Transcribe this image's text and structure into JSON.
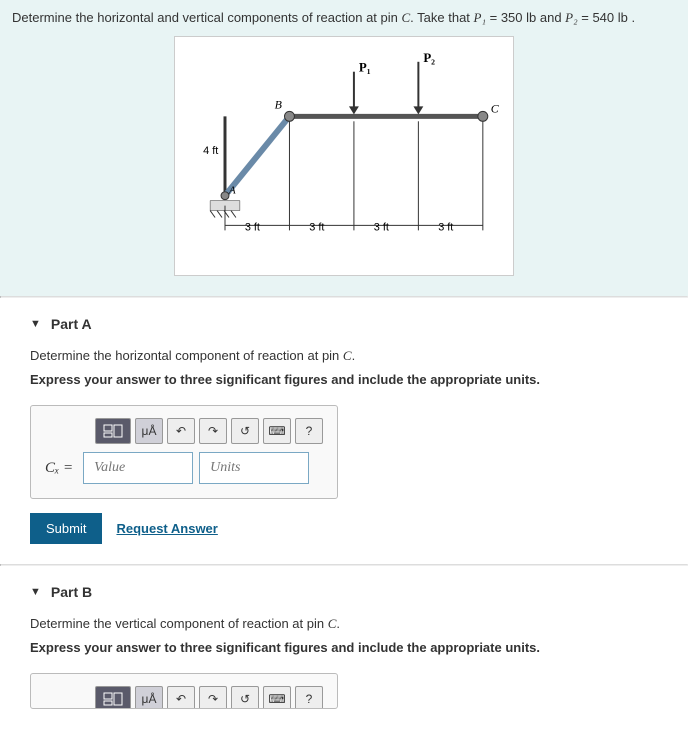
{
  "problem": {
    "statement_pre": "Determine the horizontal and vertical components of reaction at pin ",
    "pin": "C",
    "statement_mid": ". Take that ",
    "p1_var": "P₁",
    "p1_eq": " = 350 lb",
    "and": " and ",
    "p2_var": "P₂",
    "p2_eq": " = 540 lb ."
  },
  "diagram": {
    "labels": {
      "P1": "P₁",
      "P2": "P₂",
      "B": "B",
      "C": "C",
      "A": "A",
      "h": "4 ft",
      "d1": "3 ft",
      "d2": "3 ft",
      "d3": "3 ft",
      "d4": "3 ft"
    }
  },
  "partA": {
    "title": "Part A",
    "question_pre": "Determine the horizontal component of reaction at pin ",
    "question_pin": "C",
    "question_post": ".",
    "instruction": "Express your answer to three significant figures and include the appropriate units.",
    "var_label": "Cₓ = ",
    "value_ph": "Value",
    "units_ph": "Units",
    "submit": "Submit",
    "request": "Request Answer",
    "tools": {
      "mu": "μÅ",
      "undo": "↶",
      "redo": "↷",
      "reset": "↺",
      "kb": "⌨",
      "help": "?"
    }
  },
  "partB": {
    "title": "Part B",
    "question_pre": "Determine the vertical component of reaction at pin ",
    "question_pin": "C",
    "question_post": ".",
    "instruction": "Express your answer to three significant figures and include the appropriate units.",
    "tools": {
      "mu": "μÅ",
      "undo": "↶",
      "redo": "↷",
      "reset": "↺",
      "kb": "⌨",
      "help": "?"
    }
  }
}
